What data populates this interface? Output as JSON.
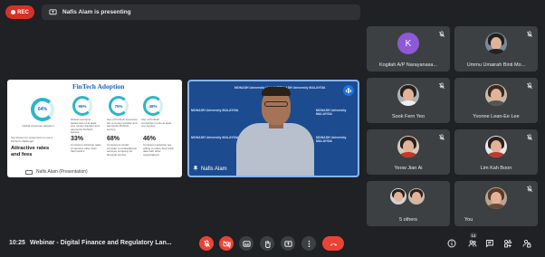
{
  "header": {
    "rec_label": "REC",
    "presenting_text": "Nafis Alam is presenting"
  },
  "slide": {
    "title": "FinTech Adoption",
    "main_percent": "64%",
    "main_caption": "Global consumer adoption",
    "left_note": "Top drivers for consumers to use a FinTech challenger:",
    "left_sub": "Attractive rates and fees",
    "ring1": "96%",
    "ring2": "75%",
    "ring3": "48%",
    "ring1_caption": "Global consumer awareness of at least one money transfer and payments FinTech service",
    "ring2_caption": "Use of FinTech insurance are a money transfer and payments FinTech service",
    "ring3_caption": "Use of FinTech comparison tools at least one service",
    "stat1": "33%",
    "stat2": "68%",
    "stat3": "46%",
    "stat1_caption": "Consumer adoption rates of services other than their bank's",
    "stat2_caption": "Consumers would consider a nontraditional services company for financial service",
    "stat3_caption": "Consumer adoption are willing to share their bank data with other organisations",
    "presenter_label": "Nafis Alam (Presentation)"
  },
  "speaker": {
    "name": "Nafis Alam",
    "brand": "MONASH University MALAYSIA"
  },
  "participants": [
    {
      "name": "Kogilah A/P Narayanasa...",
      "initial": "K"
    },
    {
      "name": "Ummu Umairah Binti Mo..."
    },
    {
      "name": "Sook Fern Yeo"
    },
    {
      "name": "Yvonne Lean-Ee Lee"
    },
    {
      "name": "Yeow Jian Ai"
    },
    {
      "name": "Lim Kah Boon"
    },
    {
      "name": "5 others"
    },
    {
      "name": "You"
    }
  ],
  "footer": {
    "time": "10:25",
    "title": "Webinar - Digital Finance and Regulatory Lan...",
    "people_count": "14"
  },
  "colors": {
    "background": "#202124",
    "tile": "#3c4043",
    "danger": "#ea4335",
    "accent": "#8ab4f8",
    "avatar_k": "#8e58d6"
  }
}
